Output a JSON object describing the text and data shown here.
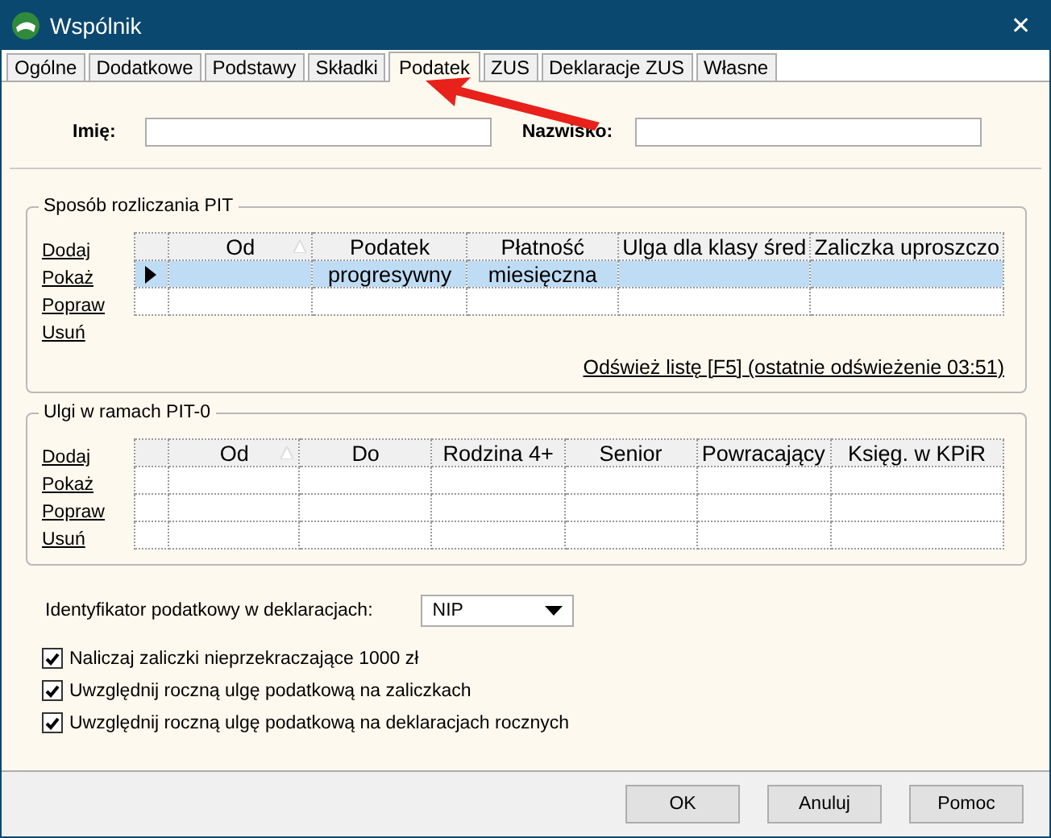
{
  "window": {
    "title": "Wspólnik",
    "close": "✕"
  },
  "tabs": [
    {
      "label": "Ogólne",
      "selected": false
    },
    {
      "label": "Dodatkowe",
      "selected": false
    },
    {
      "label": "Podstawy",
      "selected": false
    },
    {
      "label": "Składki",
      "selected": false
    },
    {
      "label": "Podatek",
      "selected": true
    },
    {
      "label": "ZUS",
      "selected": false
    },
    {
      "label": "Deklaracje ZUS",
      "selected": false
    },
    {
      "label": "Własne",
      "selected": false
    }
  ],
  "name_fields": [
    {
      "label": "Imię:"
    },
    {
      "label": "Nazwisko:"
    }
  ],
  "sections": [
    {
      "title": "Sposób rozliczania PIT",
      "actions": [
        "Dodaj",
        "Pokaż",
        "Popraw",
        "Usuń"
      ],
      "columns": [
        {
          "label": "Od",
          "sorted": true
        },
        {
          "label": "Podatek",
          "sorted": false
        },
        {
          "label": "Płatność",
          "sorted": false
        },
        {
          "label": "Ulga dla klasy śred",
          "sorted": false
        },
        {
          "label": "Zaliczka uproszczo",
          "sorted": false
        }
      ],
      "rows": [
        {
          "selected": true,
          "cells": [
            null,
            "progresywny",
            "miesięczna",
            null,
            null
          ]
        },
        {
          "selected": false
        }
      ],
      "refresh_link": "Odśwież listę [F5] (ostatnie odświeżenie 03:51)"
    },
    {
      "title": "Ulgi w ramach PIT-0",
      "actions": [
        "Dodaj",
        "Pokaż",
        "Popraw",
        "Usuń"
      ],
      "columns": [
        {
          "label": "Od",
          "sorted": true
        },
        {
          "label": "Do",
          "sorted": false
        },
        {
          "label": "Rodzina 4+",
          "sorted": false
        },
        {
          "label": "Senior",
          "sorted": false
        },
        {
          "label": "Powracający",
          "sorted": false
        },
        {
          "label": "Księg. w KPiR",
          "sorted": false
        }
      ],
      "rows": [
        {
          "selected": false
        },
        {
          "selected": false
        },
        {
          "selected": false
        }
      ]
    }
  ],
  "tax_id": {
    "label": "Identyfikator podatkowy w deklaracjach:",
    "value": "NIP"
  },
  "checkboxes": [
    {
      "label": "Naliczaj zaliczki nieprzekraczające 1000 zł",
      "checked": true
    },
    {
      "label": "Uwzględnij roczną ulgę podatkową na zaliczkach",
      "checked": true
    },
    {
      "label": "Uwzględnij roczną ulgę podatkową na deklaracjach rocznych",
      "checked": true
    }
  ],
  "buttons": [
    "OK",
    "Anuluj",
    "Pomoc"
  ]
}
